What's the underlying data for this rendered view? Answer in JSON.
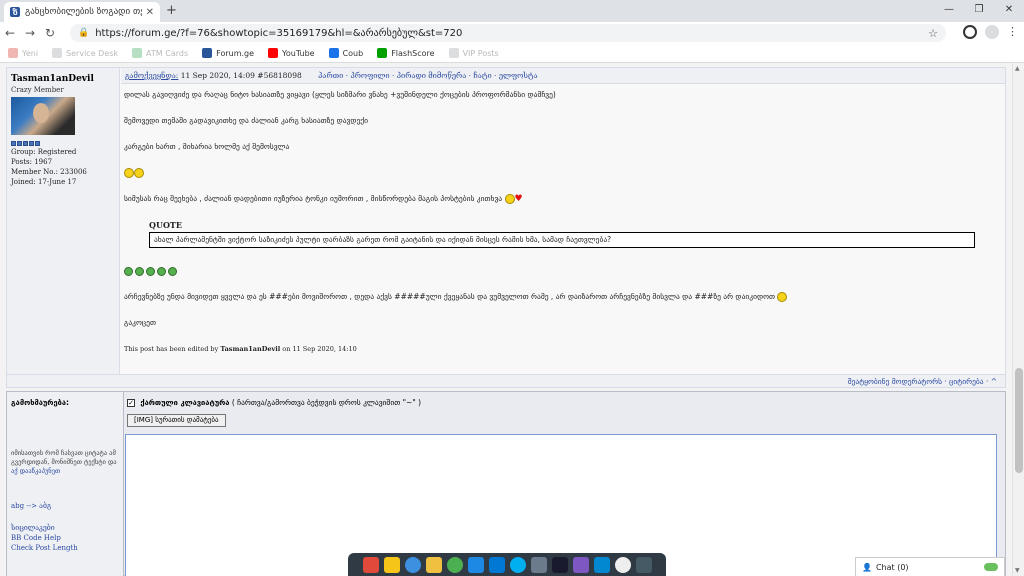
{
  "browser": {
    "tab_title": "განცხობილების ზოგადი თემ",
    "url": "https://forum.ge/?f=76&showtopic=35169179&hl=&არარსებულ&st=720",
    "bookmarks": [
      {
        "label": "Yeni",
        "color": "#d93025",
        "faded": true
      },
      {
        "label": "Service Desk",
        "color": "#9aa0a6",
        "faded": true
      },
      {
        "label": "ATM Cards",
        "color": "#34a853",
        "faded": true
      },
      {
        "label": "Forum.ge",
        "color": "#2a5599",
        "faded": false
      },
      {
        "label": "YouTube",
        "color": "#ff0000",
        "faded": false
      },
      {
        "label": "Coub",
        "color": "#1a73e8",
        "faded": false
      },
      {
        "label": "FlashScore",
        "color": "#00a000",
        "faded": false
      },
      {
        "label": "VIP Posts",
        "color": "#9aa0a6",
        "faded": true
      }
    ]
  },
  "author": {
    "name": "Tasman1anDevil",
    "title": "Crazy Member",
    "group": "Group: Registered",
    "posts": "Posts: 1967",
    "member_no": "Member No.: 233006",
    "joined": "Joined: 17-June 17"
  },
  "post": {
    "header_label": "გამოქვეყნდა:",
    "date": "11 Sep 2020, 14:09",
    "post_id": "#56818098",
    "header_links": "პართი · პროფილი · პირადი მიმოწერა · ჩატი · ელფოსტა",
    "paragraphs": [
      "დილას გავიღვიძე და რაღაც ნიტო ხასიათზე ვიყავი (ყლეს სიზმარი ვნახე +ვუშინდელი ქოცების პროფორმანსი დამჩვე)",
      "შემოვედი თემაში გადავიკითხე და ძალიან კარგ ხასიათზე დავდექი",
      "კარგები ხართ , მიხარია ხოლმე აქ შემოსვლა",
      "სიმუსას რაც შეეხება , ძალიან დადებითი იუზერია ტონკი იუმორით , მისწორდება მაგის პოსტების კითხვა"
    ],
    "quote_title": "QUOTE",
    "quote_text": "ახალ პარლამენტში ვიქტორ საზიკიძეს პულტი დარბაზს გარეთ რომ გაიტანის და იქიდან მისცეს რამის ხმა, სამად ჩაეთვლება?",
    "paragraph_after": "არჩევნებზე უნდა მივიდეთ ყველა და ეს ###ები მოვიშოროთ , დედა აქვს #####ული ქვეყანას და ვუმველოთ რამე , არ დაიზაროთ არჩევნებზე მისვლა და ###ზე არ დაიკიდოთ",
    "sign_off": "გაკოცეთ",
    "edit_prefix": "This post has been edited by",
    "edit_user": "Tasman1anDevil",
    "edit_suffix": "on 11 Sep 2020, 14:10",
    "footer_links": "შეატყობინე მოდერატორს · ციტირება · ^"
  },
  "reply": {
    "label": "გამოხმაურება:",
    "checkbox_label": "ქართული კლავიატურა",
    "checkbox_hint": "( ჩართვა/გამორთვა ბეჭდვის დროს კლავიშით \"~\" )",
    "img_button": "[IMG] სურათის დამატება",
    "hint_text": "იმისათვის რომ ჩასვათ ციტატა ამ გვერდიდან, მონიშნეთ ტექსტი და",
    "hint_link": "აქ დააწკაპუნეთ",
    "link_translit": "abg --> აბგ",
    "link_smiles": "სიცილაკები",
    "link_bbcode": "BB Code Help",
    "link_check": "Check Post Length"
  },
  "chat": {
    "label": "Chat (0)"
  }
}
